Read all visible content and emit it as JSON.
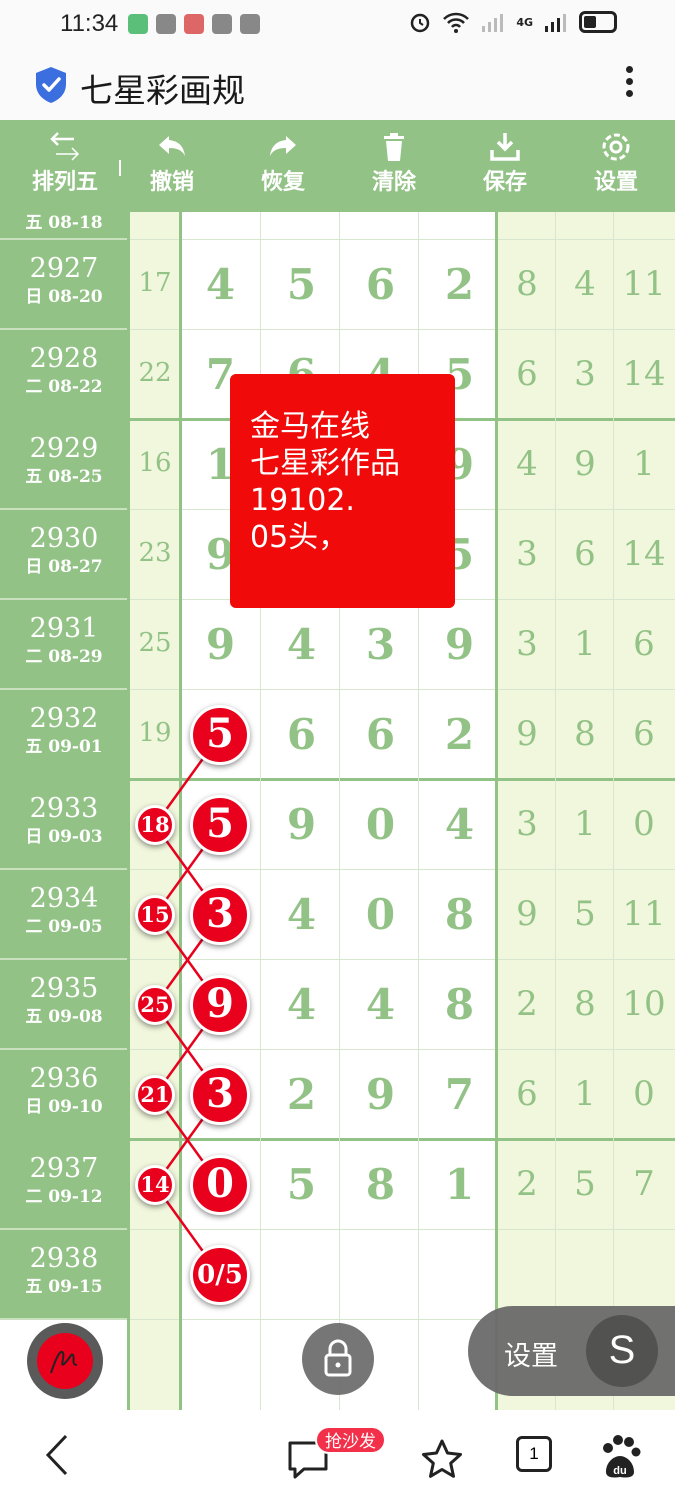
{
  "status_bar": {
    "time": "11:34",
    "network": "4G"
  },
  "app": {
    "title": "七星彩画规"
  },
  "toolbar": {
    "items": [
      {
        "label": "排列五",
        "icon": "swap-arrows-icon"
      },
      {
        "label": "撤销",
        "icon": "undo-icon"
      },
      {
        "label": "恢复",
        "icon": "redo-icon"
      },
      {
        "label": "清除",
        "icon": "trash-icon"
      },
      {
        "label": "保存",
        "icon": "download-icon"
      },
      {
        "label": "设置",
        "icon": "gear-icon"
      }
    ]
  },
  "partial_top_row": {
    "date": "五 08-18"
  },
  "rows": [
    {
      "issue": "2927",
      "date": "日 08-20",
      "sum": "17",
      "d": [
        "4",
        "5",
        "6",
        "2"
      ],
      "e": [
        "8",
        "4",
        "11"
      ]
    },
    {
      "issue": "2928",
      "date": "二 08-22",
      "sum": "22",
      "d": [
        "7",
        "6",
        "4",
        "5"
      ],
      "e": [
        "6",
        "3",
        "14"
      ]
    },
    {
      "issue": "2929",
      "date": "五 08-25",
      "sum": "16",
      "d": [
        "1",
        "",
        "",
        "9"
      ],
      "e": [
        "4",
        "9",
        "1"
      ]
    },
    {
      "issue": "2930",
      "date": "日 08-27",
      "sum": "23",
      "d": [
        "9",
        "",
        "",
        "5"
      ],
      "e": [
        "3",
        "6",
        "14"
      ]
    },
    {
      "issue": "2931",
      "date": "二 08-29",
      "sum": "25",
      "d": [
        "9",
        "4",
        "3",
        "9"
      ],
      "e": [
        "3",
        "1",
        "6"
      ]
    },
    {
      "issue": "2932",
      "date": "五 09-01",
      "sum": "19",
      "d": [
        "5",
        "6",
        "6",
        "2"
      ],
      "e": [
        "9",
        "8",
        "6"
      ]
    },
    {
      "issue": "2933",
      "date": "日 09-03",
      "sum": "18",
      "d": [
        "5",
        "9",
        "0",
        "4"
      ],
      "e": [
        "3",
        "1",
        "0"
      ]
    },
    {
      "issue": "2934",
      "date": "二 09-05",
      "sum": "15",
      "d": [
        "3",
        "4",
        "0",
        "8"
      ],
      "e": [
        "9",
        "5",
        "11"
      ]
    },
    {
      "issue": "2935",
      "date": "五 09-08",
      "sum": "25",
      "d": [
        "9",
        "4",
        "4",
        "8"
      ],
      "e": [
        "2",
        "8",
        "10"
      ]
    },
    {
      "issue": "2936",
      "date": "日 09-10",
      "sum": "21",
      "d": [
        "3",
        "2",
        "9",
        "7"
      ],
      "e": [
        "6",
        "1",
        "0"
      ]
    },
    {
      "issue": "2937",
      "date": "二 09-12",
      "sum": "14",
      "d": [
        "0",
        "5",
        "8",
        "1"
      ],
      "e": [
        "2",
        "5",
        "7"
      ]
    },
    {
      "issue": "2938",
      "date": "五 09-15",
      "sum": "",
      "d": [
        "0/5",
        "",
        "",
        ""
      ],
      "e": [
        "",
        "",
        ""
      ]
    }
  ],
  "marked": {
    "first_digit_rows": [
      5,
      6,
      7,
      8,
      9,
      10,
      11
    ],
    "sum_rows": [
      6,
      7,
      8,
      9,
      10
    ]
  },
  "note": {
    "lines": [
      "金马在线",
      "七星彩作品",
      "19102.",
      "05头，"
    ]
  },
  "floating": {
    "settings_label": "设置",
    "settings_circle": "S"
  },
  "bottom_bar": {
    "badge": "抢沙发",
    "tab_count": "1"
  },
  "colors": {
    "green": "#93c286",
    "light_green": "#f0f7dc",
    "red": "#e8001c",
    "note_red": "#f00a0a"
  }
}
